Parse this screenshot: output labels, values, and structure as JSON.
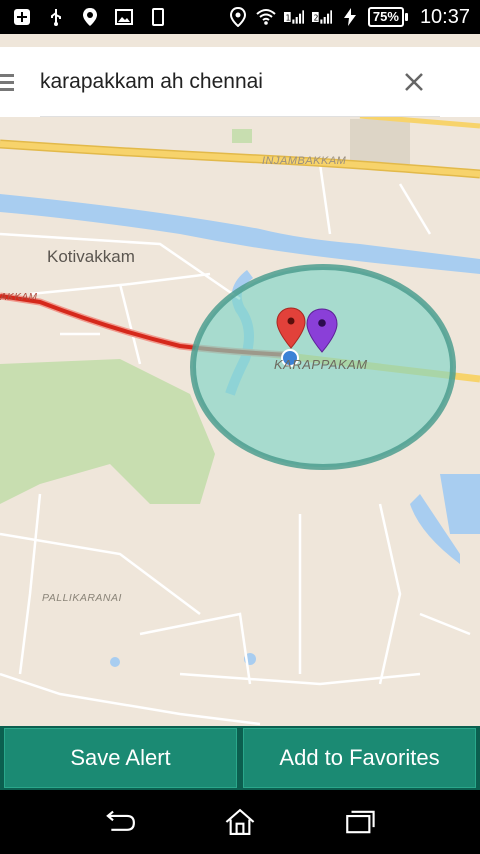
{
  "status_bar": {
    "battery_text": "75%",
    "time": "10:37",
    "icons": [
      "plus-icon",
      "usb-icon",
      "location-icon",
      "image-icon",
      "phone-icon",
      "location-icon",
      "wifi-icon",
      "signal-sim1-icon",
      "signal-sim2-icon",
      "charging-icon",
      "battery-icon"
    ]
  },
  "search": {
    "value": "karapakkam ah chennai",
    "placeholder": ""
  },
  "map": {
    "labels": {
      "kotivakkam": "Kotivakkam",
      "injambakkam": "INJAMBAKKAM",
      "karapakkam": "KARAPPAKAM",
      "pallikaranai": "PALLIKARANAI",
      "left_road": "AKKAM"
    },
    "colors": {
      "land": "#efe6da",
      "water": "#a8cdf0",
      "park": "#c8deb0",
      "highway": "#f7d36b",
      "route": "#d5281b",
      "radius_fill": "#7fd6c7",
      "radius_stroke": "#4e9e8f",
      "pin_red": "#e2413a",
      "pin_purple": "#8a3fd8",
      "current_location": "#3b82d6"
    }
  },
  "actions": {
    "save_alert": "Save Alert",
    "add_favorites": "Add to Favorites"
  },
  "colors": {
    "action_bar": "#0b5f4f",
    "action_button": "#1b8a73"
  }
}
